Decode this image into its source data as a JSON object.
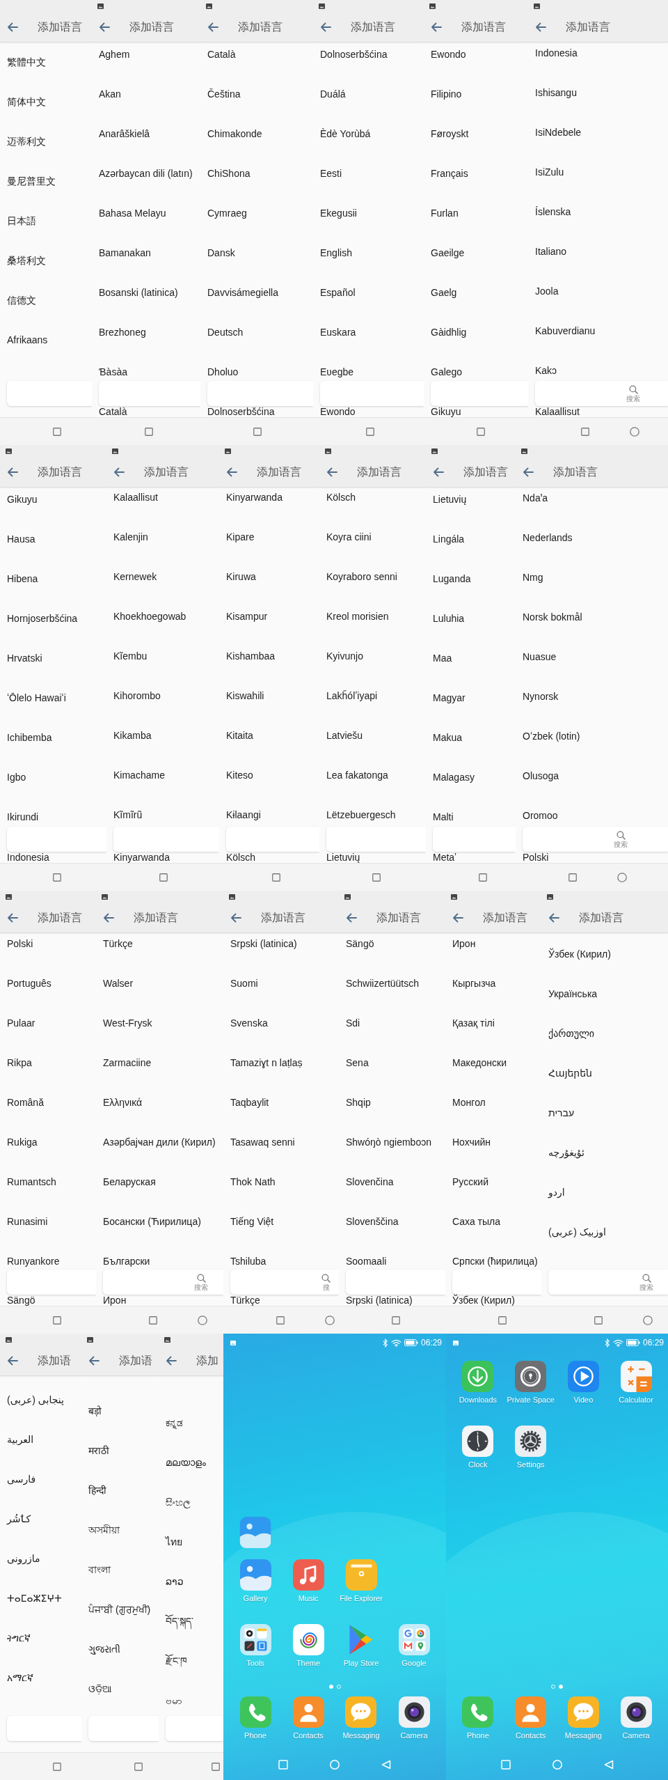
{
  "rows": [
    {
      "screens": [
        {
          "kind": "languages",
          "title": "添加语言",
          "languages": [
            "繁體中文",
            "简体中文",
            "迈蒂利文",
            "曼尼普里文",
            "日本語",
            "桑塔利文",
            "信德文",
            "Afrikaans"
          ]
        },
        {
          "kind": "languages",
          "title": "添加语言",
          "languages": [
            "Aghem",
            "Akan",
            "Anarâškielâ",
            "Azərbaycan dili (latın)",
            "Bahasa Melayu",
            "Bamanakan",
            "Bosanski (latinica)",
            "Brezhoneg",
            "Ɓàsàa"
          ],
          "next_language": "Català"
        },
        {
          "kind": "languages",
          "title": "添加语言",
          "languages": [
            "Català",
            "Čeština",
            "Chimakonde",
            "ChiShona",
            "Cymraeg",
            "Dansk",
            "Davvisámegiella",
            "Deutsch",
            "Dholuo"
          ],
          "next_language": "Dolnoserbšćina"
        },
        {
          "kind": "languages",
          "title": "添加语言",
          "languages": [
            "Dolnoserbšćina",
            "Duálá",
            "Èdè Yorùbá",
            "Eesti",
            "Ekegusii",
            "English",
            "Español",
            "Euskara",
            "Eʋegbe"
          ],
          "next_language": "Ewondo"
        },
        {
          "kind": "languages",
          "title": "添加语言",
          "languages": [
            "Ewondo",
            "Filipino",
            "Føroyskt",
            "Français",
            "Furlan",
            "Gaeilge",
            "Gaelg",
            "Gàidhlig",
            "Galego"
          ],
          "next_language": "Gikuyu"
        },
        {
          "kind": "languages",
          "title": "添加语言",
          "languages": [
            "Indonesia",
            "Ishisangu",
            "IsiNdebele",
            "IsiZulu",
            "Íslenska",
            "Italiano",
            "Joola",
            "Kabuverdianu",
            "Kakɔ"
          ],
          "next_language": "Kalaallisut",
          "search_label": "搜索"
        }
      ]
    },
    {
      "screens": [
        {
          "kind": "languages",
          "title": "添加语言",
          "languages": [
            "Gikuyu",
            "Hausa",
            "Hibena",
            "Hornjoserbšćina",
            "Hrvatski",
            "ʻŌlelo Hawaiʻi",
            "Ichibemba",
            "Igbo",
            "Ikirundi"
          ],
          "next_language": "Indonesia"
        },
        {
          "kind": "languages",
          "title": "添加语言",
          "languages": [
            "Kalaallisut",
            "Kalenjin",
            "Kernewek",
            "Khoekhoegowab",
            "Kĩembu",
            "Kihorombo",
            "Kikamba",
            "Kimachame",
            "Kĩmĩrũ"
          ],
          "next_language": "Kinyarwanda"
        },
        {
          "kind": "languages",
          "title": "添加语言",
          "languages": [
            "Kinyarwanda",
            "Kipare",
            "Kiruwa",
            "Kisampur",
            "Kishambaa",
            "Kiswahili",
            "Kitaita",
            "Kiteso",
            "Kɨlaangi"
          ],
          "next_language": "Kölsch"
        },
        {
          "kind": "languages",
          "title": "添加语言",
          "languages": [
            "Kölsch",
            "Koyra ciini",
            "Koyraboro senni",
            "Kreol morisien",
            "Kyivunjo",
            "Lakȟólʼiyapi",
            "Latviešu",
            "Lea fakatonga",
            "Lëtzebuergesch"
          ],
          "next_language": "Lietuvių"
        },
        {
          "kind": "languages",
          "title": "添加语言",
          "languages": [
            "Lietuvių",
            "Lingála",
            "Luganda",
            "Luluhia",
            "Maa",
            "Magyar",
            "Makua",
            "Malagasy",
            "Malti"
          ],
          "next_language": "Metaʼ"
        },
        {
          "kind": "languages",
          "title": "添加语言",
          "languages": [
            "Ndaꞌa",
            "Nederlands",
            "Nmg",
            "Norsk bokmål",
            "Nuasue",
            "Nynorsk",
            "Oʻzbek (lotin)",
            "Olusoga",
            "Oromoo"
          ],
          "next_language": "Polski",
          "search_label": "搜索"
        }
      ]
    },
    {
      "screens": [
        {
          "kind": "languages",
          "title": "添加语言",
          "languages": [
            "Polski",
            "Português",
            "Pulaar",
            "Rikpa",
            "Română",
            "Rukiga",
            "Rumantsch",
            "Runasimi",
            "Runyankore"
          ],
          "next_language": "Sängö"
        },
        {
          "kind": "languages",
          "title": "添加语言",
          "languages": [
            "Türkçe",
            "Walser",
            "West-Frysk",
            "Zarmaciine",
            "Ελληνικά",
            "Азәрбајҹан дили (Кирил)",
            "Беларуская",
            "Босански (Ћирилица)",
            "Български"
          ],
          "next_language": "Ирон",
          "search_label": "搜索"
        },
        {
          "kind": "languages",
          "title": "添加语言",
          "languages": [
            "Srpski (latinica)",
            "Suomi",
            "Svenska",
            "Tamaziɣt n laṭlaṣ",
            "Taqbaylit",
            "Tasawaq senni",
            "Thok Nath",
            "Tiếng Việt",
            "Tshiluba"
          ],
          "next_language": "Türkçe",
          "search_label": "搜"
        },
        {
          "kind": "languages",
          "title": "添加语言",
          "languages": [
            "Sängö",
            "Schwiizertüütsch",
            "Sdi",
            "Sena",
            "Shqip",
            "Shwóŋò ngiemboɔn",
            "Slovenčina",
            "Slovenščina",
            "Soomaali"
          ],
          "next_language": "Srpski (latinica)"
        },
        {
          "kind": "languages",
          "title": "添加语言",
          "languages": [
            "Ирон",
            "Кыргызча",
            "Қазақ тілі",
            "Македонски",
            "Монгол",
            "Нохчийн",
            "Русский",
            "Саха тыла",
            "Српски (ћирилица)"
          ],
          "next_language": "Ўзбек (Кирил)"
        },
        {
          "kind": "languages",
          "title": "添加语言",
          "languages": [
            "Ўзбек (Кирил)",
            "Українська",
            "ქართული",
            "Հայերեն",
            "עברית",
            "ئۇيغۇرچە",
            "اردو",
            "اوزبیک (عربی)"
          ],
          "search_label": "搜索"
        }
      ]
    },
    {
      "screens": [
        {
          "kind": "languages",
          "title": "添加语",
          "languages": [
            "پنجابی (عربی)",
            "العربية",
            "فارسی",
            "کٲشُر",
            "مازرونی",
            "ⵜⴰⵎⴰⵣⵉⵖⵜ",
            "ትግርኛ",
            "አማርኛ"
          ]
        },
        {
          "kind": "languages",
          "title": "添加语",
          "languages": [
            "बड़ो",
            "मराठी",
            "हिन्दी",
            "অসমীয়া",
            "বাংলা",
            "ਪੰਜਾਬੀ (ਗੁਰਮੁਖੀ)",
            "ગુજરાતી",
            "ଓଡ଼ିଆ"
          ]
        },
        {
          "kind": "languages",
          "title": "添加",
          "languages": [
            "ಕನ್ನಡ",
            "മലയാളം",
            "සිංහල",
            "ไทย",
            "ລາວ",
            "བོད་སྐད་",
            "རྫོང་ཁ",
            "ဗမာ"
          ]
        },
        {
          "kind": "home",
          "time": "06:29",
          "app_rows": [
            [
              {
                "label": "Gallery",
                "kind": "gallery",
                "dragging": true
              },
              {
                "label": "Music",
                "kind": "music",
                "dragging": false
              },
              {
                "label": "File Explorer",
                "kind": "files",
                "dragging": false
              }
            ],
            [
              {
                "label": "Tools",
                "kind": "tools",
                "dragging": false
              },
              {
                "label": "Theme",
                "kind": "theme",
                "dragging": false
              },
              {
                "label": "Play Store",
                "kind": "store",
                "dragging": false
              },
              {
                "label": "Google",
                "kind": "google",
                "dragging": false
              }
            ]
          ],
          "pages": [
            {
              "selected": true
            },
            {
              "selected": false
            }
          ],
          "dock": [
            {
              "label": "Phone",
              "kind": "phone"
            },
            {
              "label": "Contacts",
              "kind": "contacts"
            },
            {
              "label": "Messaging",
              "kind": "messaging"
            },
            {
              "label": "Camera",
              "kind": "camera"
            }
          ]
        },
        {
          "kind": "home",
          "time": "06:29",
          "app_rows": [
            [
              {
                "label": "Downloads",
                "kind": "downloads",
                "dragging": false
              },
              {
                "label": "Private Space",
                "kind": "private",
                "dragging": false
              },
              {
                "label": "Video",
                "kind": "video",
                "dragging": false
              },
              {
                "label": "Calculator",
                "kind": "calculator",
                "dragging": false
              }
            ],
            [
              {
                "label": "Clock",
                "kind": "clock",
                "dragging": false
              },
              {
                "label": "Settings",
                "kind": "settings",
                "dragging": false
              }
            ]
          ],
          "pages": [
            {
              "selected": false
            },
            {
              "selected": true
            }
          ],
          "dock": [
            {
              "label": "Phone",
              "kind": "phone"
            },
            {
              "label": "Contacts",
              "kind": "contacts"
            },
            {
              "label": "Messaging",
              "kind": "messaging"
            },
            {
              "label": "Camera",
              "kind": "camera"
            }
          ]
        }
      ]
    }
  ]
}
